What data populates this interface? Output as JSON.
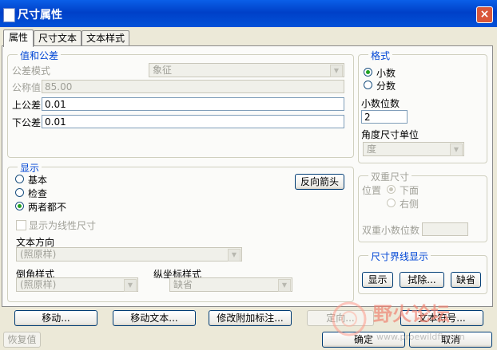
{
  "window": {
    "title": "尺寸属性",
    "close": "×"
  },
  "tabs": [
    "属性",
    "尺寸文本",
    "文本样式"
  ],
  "value_tolerance": {
    "legend": "值和公差",
    "tol_mode_label": "公差模式",
    "tol_mode_value": "象征",
    "nominal_label": "公称值",
    "nominal_value": "85.00",
    "upper_label": "上公差",
    "upper_value": "0.01",
    "lower_label": "下公差",
    "lower_value": "0.01"
  },
  "format": {
    "legend": "格式",
    "decimal": "小数",
    "fraction": "分数",
    "decimal_places_label": "小数位数",
    "decimal_places_value": "2",
    "angle_unit_label": "角度尺寸单位",
    "angle_unit_value": "度"
  },
  "display": {
    "legend": "显示",
    "basic": "基本",
    "inspect": "检查",
    "neither": "两者都不",
    "flip_arrows": "反向箭头",
    "show_linear": "显示为线性尺寸",
    "text_direction_label": "文本方向",
    "text_direction_value": "(照原样)",
    "chamfer_label": "倒角样式",
    "chamfer_value": "(照原样)",
    "ordinate_label": "纵坐标样式",
    "ordinate_value": "缺省"
  },
  "dual": {
    "legend": "双重尺寸",
    "position_label": "位置",
    "below": "下面",
    "right": "右侧",
    "dual_places_label": "双重小数位数"
  },
  "witness": {
    "legend": "尺寸界线显示",
    "show": "显示",
    "erase": "拭除...",
    "default": "缺省"
  },
  "bottom": {
    "move": "移动...",
    "move_text": "移动文本...",
    "modify_attach": "修改附加标注...",
    "orient": "定向...",
    "text_symbol": "文本符号...",
    "restore": "恢复值",
    "ok": "确定",
    "cancel": "取消"
  },
  "watermark": {
    "text": "野火论坛",
    "url": "www.proewildfire.cn"
  },
  "colors": {
    "title_bar": "#0a5fe8",
    "legend": "#0046d5",
    "window_bg": "#ece9d8"
  }
}
